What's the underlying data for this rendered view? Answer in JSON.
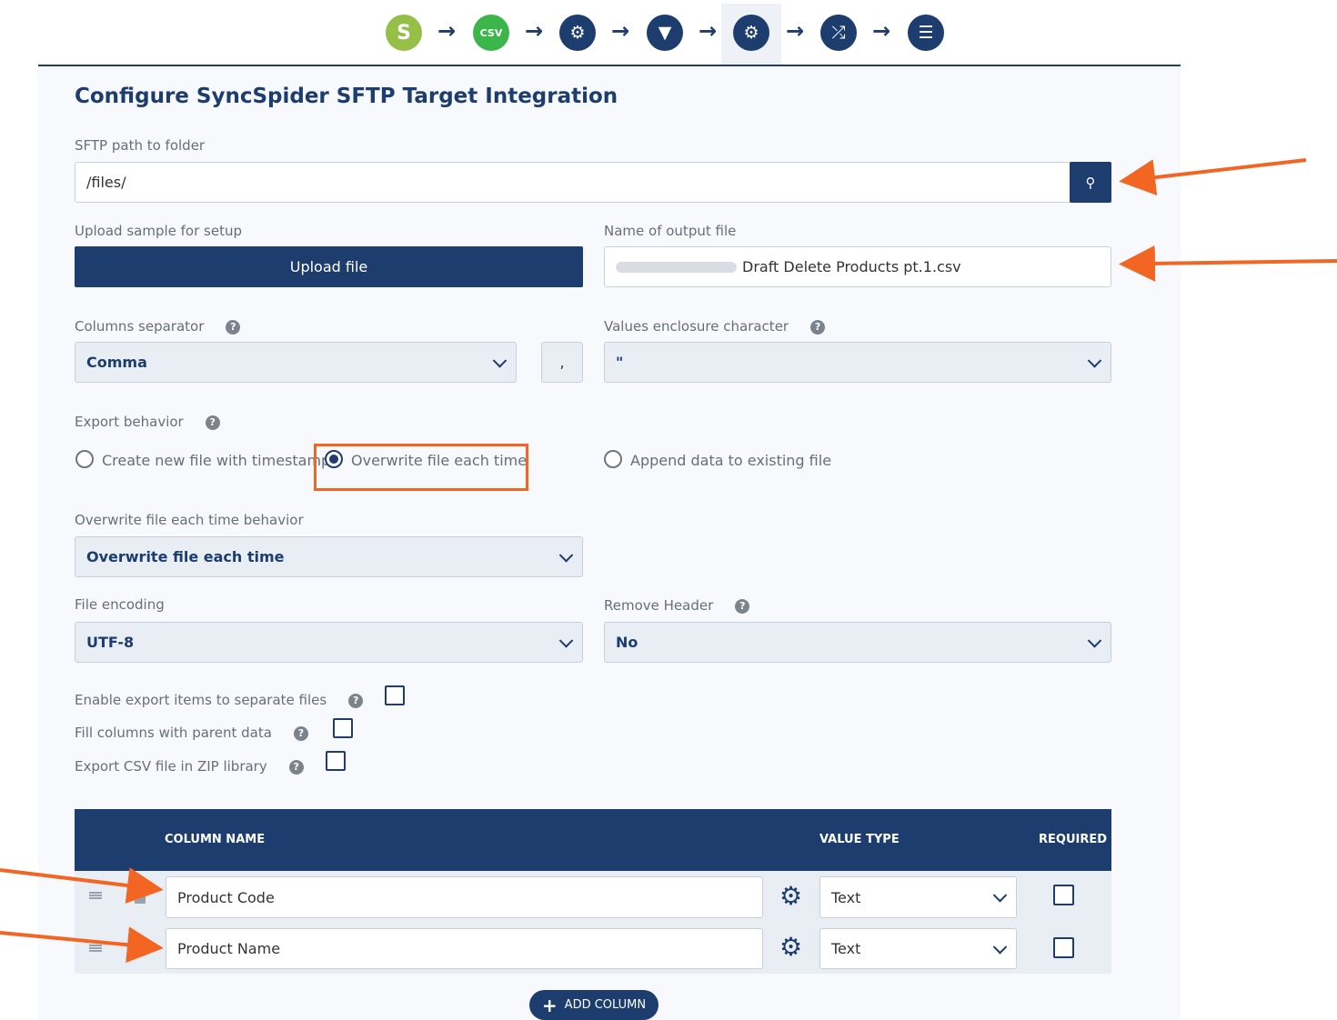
{
  "steps": [
    {
      "icon": "shopify-icon",
      "glyph": "S"
    },
    {
      "icon": "csv-icon",
      "glyph": "CSV"
    },
    {
      "icon": "gear-icon",
      "glyph": "⚙"
    },
    {
      "icon": "filter-icon",
      "glyph": "▼"
    },
    {
      "icon": "gear-icon",
      "glyph": "⚙"
    },
    {
      "icon": "shuffle-icon",
      "glyph": "⤮"
    },
    {
      "icon": "sliders-icon",
      "glyph": "☰"
    }
  ],
  "page_title": "Configure SyncSpider SFTP Target Integration",
  "sftp": {
    "label": "SFTP path to folder",
    "value": "/files/"
  },
  "upload": {
    "label": "Upload sample for setup",
    "button": "Upload file"
  },
  "output_file": {
    "label": "Name of output file",
    "value": "Draft Delete Products pt.1.csv"
  },
  "separator": {
    "label": "Columns separator",
    "selected": "Comma",
    "char": ","
  },
  "enclosure": {
    "label": "Values enclosure character",
    "selected": "\""
  },
  "export_behavior": {
    "label": "Export behavior",
    "options": [
      "Create new file with timestamp",
      "Overwrite file each time",
      "Append data to existing file"
    ],
    "selected_index": 1
  },
  "overwrite_behavior": {
    "label": "Overwrite file each time behavior",
    "selected": "Overwrite file each time"
  },
  "encoding": {
    "label": "File encoding",
    "selected": "UTF-8"
  },
  "remove_header": {
    "label": "Remove Header",
    "selected": "No"
  },
  "checkboxes": [
    {
      "label": "Enable export items to separate files",
      "checked": false
    },
    {
      "label": "Fill columns with parent data",
      "checked": false
    },
    {
      "label": "Export CSV file in ZIP library",
      "checked": false
    }
  ],
  "table": {
    "headers": {
      "column_name": "COLUMN NAME",
      "value_type": "VALUE TYPE",
      "required": "REQUIRED"
    },
    "rows": [
      {
        "name": "Product Code",
        "type": "Text",
        "required": false
      },
      {
        "name": "Product Name",
        "type": "Text",
        "required": false
      }
    ]
  },
  "add_column": "ADD COLUMN",
  "help_glyph": "?",
  "colors": {
    "primary": "#1c3d6e",
    "annotation": "#f26522",
    "csv": "#3cb54a"
  }
}
